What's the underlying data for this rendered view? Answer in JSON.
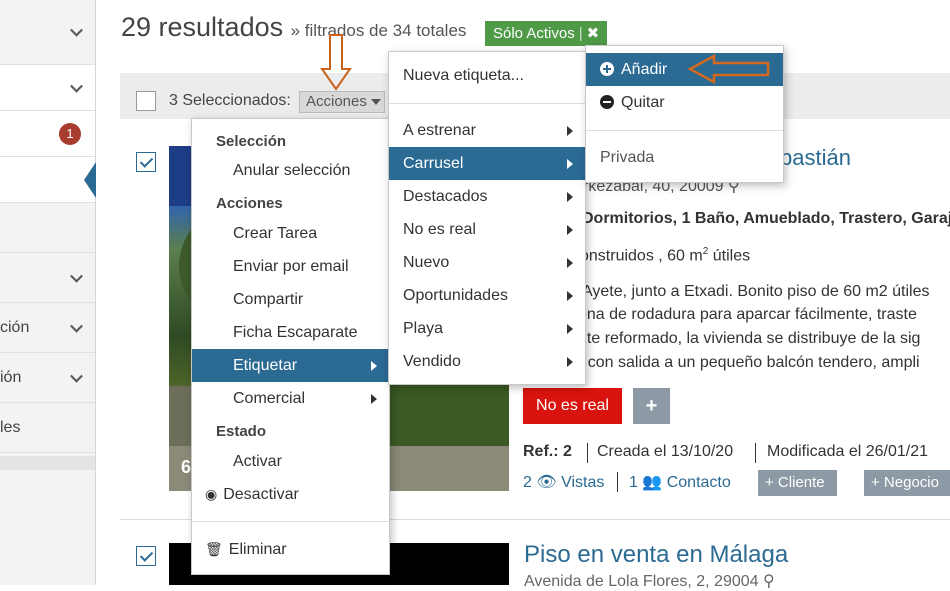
{
  "sidebar": {
    "items": [
      {
        "label": ""
      },
      {
        "label": ""
      },
      {
        "label": "",
        "badge": "1"
      },
      {
        "label": ""
      },
      {
        "label": ""
      },
      {
        "label": ""
      },
      {
        "label": "ción"
      },
      {
        "label": "ión"
      },
      {
        "label": "les"
      }
    ]
  },
  "header": {
    "count": "29 resultados",
    "filter_text": "» filtrados de 34 totales",
    "filter_badge": "Sólo Activos",
    "filter_badge_sep": "|",
    "filter_close": "✖"
  },
  "toolbar": {
    "selected_text": "3 Seleccionados:",
    "actions_label": "Acciones"
  },
  "actions_menu": {
    "section_selection": "Selección",
    "deselect": "Anular selección",
    "section_actions": "Acciones",
    "create_task": "Crear Tarea",
    "send_email": "Enviar por email",
    "share": "Compartir",
    "window_sheet": "Ficha Escaparate",
    "tag": "Etiquetar",
    "commercial": "Comercial",
    "section_state": "Estado",
    "activate": "Activar",
    "deactivate": "Desactivar",
    "delete": "Eliminar"
  },
  "tag_menu": {
    "new_tag": "Nueva etiqueta...",
    "items": [
      "A estrenar",
      "Carrusel",
      "Destacados",
      "No es real",
      "Nuevo",
      "Oportunidades",
      "Playa",
      "Vendido"
    ]
  },
  "tag_submenu": {
    "add": "Añadir",
    "remove": "Quitar",
    "private": "Privada"
  },
  "listing1": {
    "title_tail": "bastián",
    "address": "rkezabal, 40, 20009",
    "features": "Dormitorios, 1 Baño, Amueblado, Trastero, Garaje",
    "area_a": "onstruidos , 60 m",
    "area_sup": "2",
    "area_b": " útiles",
    "desc1": "Ayete, junto a Etxadi. Bonito piso de 60 m2 útiles",
    "desc2": "ona de rodadura para aparcar fácilmente, traste",
    "desc3": "nte reformado, la vivienda se distribuye de la sig",
    "desc4": "r con salida a un pequeño balcón tendero, ampli",
    "photo_count": "6",
    "tag_label": "No es real",
    "tag_add": "+",
    "ref": "Ref.: 2",
    "created": "Creada el 13/10/20",
    "modified": "Modificada el 26/01/21",
    "views": "2 👁 Vistas",
    "contacts": "1 👥 Contacto",
    "client_btn": "+ Cliente",
    "deal_btn": "+ Negocio"
  },
  "listing2": {
    "title": "Piso en venta en Málaga",
    "address": "Avenida de Lola Flores, 2, 29004"
  },
  "colors": {
    "accent": "#2b6a93",
    "filter_green": "#4f9a47",
    "danger": "#d9130d",
    "annotation": "#c8641a"
  }
}
